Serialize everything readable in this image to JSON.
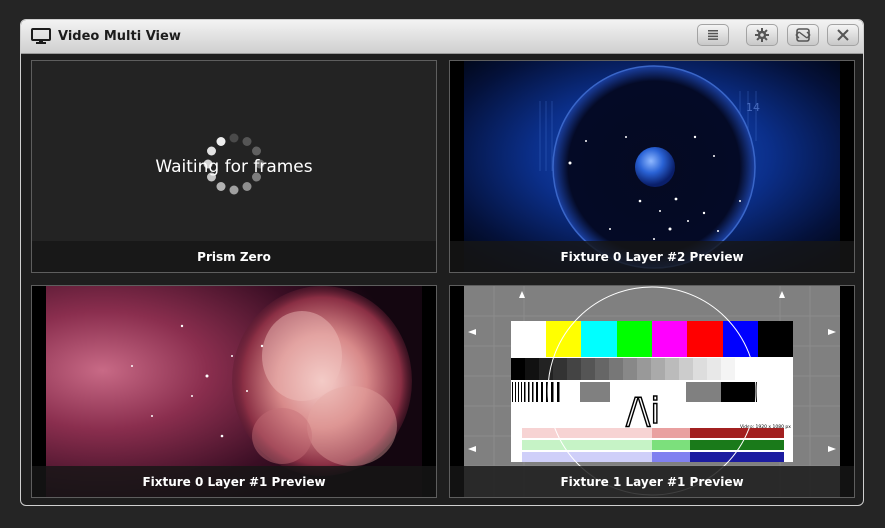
{
  "window": {
    "title": "Video Multi View",
    "title_icon": "monitor-icon",
    "buttons": [
      {
        "name": "menu",
        "icon": "menu-icon"
      },
      {
        "name": "settings",
        "icon": "gear-icon"
      },
      {
        "name": "fullscreen",
        "icon": "fullscreen-icon"
      },
      {
        "name": "close",
        "icon": "close-icon"
      }
    ]
  },
  "tiles": [
    {
      "label": "Prism Zero",
      "status_text": "Waiting for frames",
      "content": "loading-spinner"
    },
    {
      "label": "Fixture 0 Layer #2 Preview",
      "content": "blue-sphere-preview"
    },
    {
      "label": "Fixture 0 Layer #1 Preview",
      "content": "red-nebula-preview"
    },
    {
      "label": "Fixture 1 Layer #1 Preview",
      "content": "test-pattern-preview"
    }
  ],
  "test_pattern": {
    "logo": "/\\i",
    "caption": "Video: 1920 x 1080 px",
    "colors": [
      "#ffffff",
      "#ffff00",
      "#00ffff",
      "#00ff00",
      "#ff00ff",
      "#ff0000",
      "#0000ff",
      "#000000"
    ]
  }
}
